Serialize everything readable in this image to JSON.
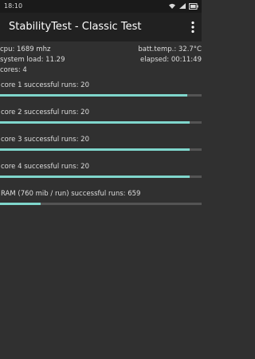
{
  "status_bar": {
    "time": "18:10",
    "icons": [
      "wifi-icon",
      "signal-icon",
      "battery-icon"
    ]
  },
  "app_bar": {
    "title": "StabilityTest - Classic Test",
    "menu_icon": "overflow-menu-icon"
  },
  "info": {
    "cpu": "cpu: 1689 mhz",
    "batt_temp": "batt.temp.: 32.7°C",
    "system_load": "system load: 11.29",
    "elapsed": "elapsed: 00:11:49",
    "cores": "cores: 4"
  },
  "runs": [
    {
      "label": "core 1 successful runs: 20",
      "progress": 0.93
    },
    {
      "label": "core 2 successful runs: 20",
      "progress": 0.94
    },
    {
      "label": "core 3 successful runs: 20",
      "progress": 0.94
    },
    {
      "label": "core 4 successful runs: 20",
      "progress": 0.94
    },
    {
      "label": "RAM (760 mib / run) successful runs: 659",
      "progress": 0.2
    }
  ],
  "colors": {
    "background": "#303030",
    "app_bar": "#212121",
    "progress_fill": "#7fd6cc",
    "progress_track": "#545454"
  }
}
